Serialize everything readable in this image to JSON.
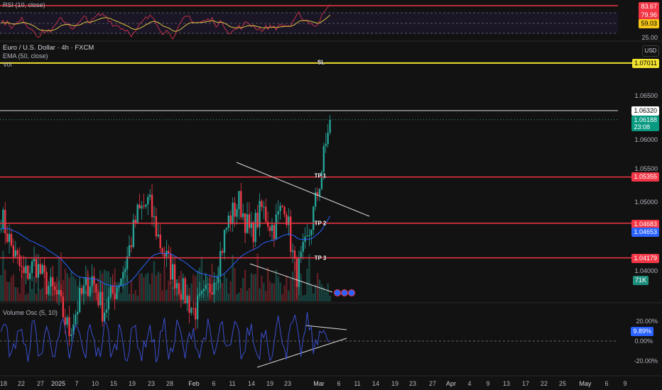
{
  "rsi": {
    "title": "RSI (10, close)",
    "value_tag": "83.67",
    "signal_tag": "79.96",
    "ma_tag": "59.03",
    "axis_25": "25.00",
    "value": 83.67,
    "signal": 79.96,
    "ma": 59.03
  },
  "main": {
    "symbol_title": "Euro / U.S. Dollar · 4h · FXCM",
    "ema_title": "EMA (50, close)",
    "vol_title": "Vol",
    "currency_button": "USD",
    "levels": {
      "sl": {
        "label": "SL",
        "price": "1.07011"
      },
      "tp1": {
        "label": "TP 1",
        "price": "1.05355"
      },
      "tp2": {
        "label": "TP 2",
        "price": "1.04683"
      },
      "tp3": {
        "label": "TP 3",
        "price": "1.04179"
      }
    },
    "last_price": "1.06188",
    "countdown": "23:08",
    "high_line": "1.06320",
    "ema_value": "1.04653",
    "volume": "71K",
    "price_axis": [
      "1.06500",
      "1.06000",
      "1.05500",
      "1.05000",
      "1.04000"
    ]
  },
  "volosc": {
    "title": "Volume Osc (5, 10)",
    "value": "9.89%",
    "axis": [
      "20.00%",
      "0.00%",
      "-20.00%"
    ]
  },
  "time_axis": [
    "18",
    "22",
    "27",
    "2025",
    "7",
    "10",
    "15",
    "19",
    "23",
    "28",
    "Feb",
    "6",
    "11",
    "14",
    "19",
    "23",
    "Mar",
    "6",
    "11",
    "14",
    "19",
    "23",
    "27",
    "Apr",
    "4",
    "9",
    "13",
    "17",
    "22",
    "25",
    "May",
    "6",
    "9"
  ],
  "colors": {
    "up": "#26a69a",
    "down": "#f23645",
    "ema": "#2962ff",
    "sl": "#f0e130",
    "level": "#f23645"
  },
  "chart_data": {
    "type": "candlestick",
    "title": "Euro / U.S. Dollar · 4h · FXCM",
    "ylim": [
      1.0285,
      1.0745
    ],
    "close_path": [
      1.048,
      1.043,
      1.039,
      1.041,
      1.038,
      1.036,
      1.031,
      1.036,
      1.039,
      1.034,
      1.037,
      1.041,
      1.048,
      1.05,
      1.044,
      1.04,
      1.037,
      1.034,
      1.036,
      1.04,
      1.047,
      1.05,
      1.045,
      1.049,
      1.046,
      1.05,
      1.039,
      1.044,
      1.052,
      1.0619
    ],
    "levels": {
      "SL": 1.07011,
      "TP 1": 1.05355,
      "TP 2": 1.04683,
      "TP 3": 1.04179,
      "high": 1.0632
    },
    "last": 1.06188,
    "ema50": 1.04653
  }
}
